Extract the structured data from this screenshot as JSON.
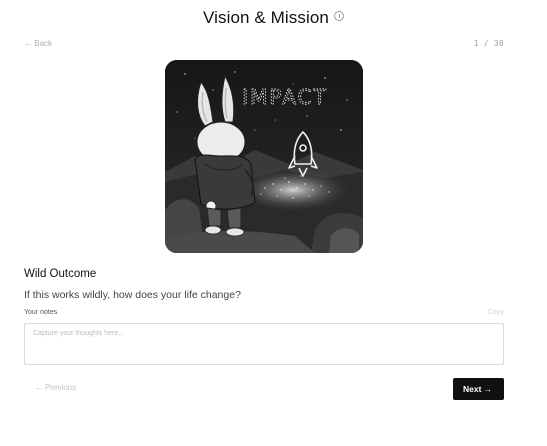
{
  "header": {
    "title": "Vision & Mission"
  },
  "nav": {
    "back_arrow": "←",
    "back_label": "Back",
    "counter": "1 / 30"
  },
  "hero": {
    "image_text": "IMPACT",
    "icon_names": [
      "bunny-illustration",
      "rocket-icon"
    ]
  },
  "prompt": {
    "title": "Wild Outcome",
    "question": "If this works wildly, how does your life change?"
  },
  "notes": {
    "label": "Your notes",
    "copy_label": "Copy",
    "placeholder": "Capture your thoughts here...",
    "value": ""
  },
  "footer": {
    "prev_arrow": "←",
    "prev_label": "Previous",
    "next_label": "Next",
    "next_arrow": "→"
  },
  "colors": {
    "accent": "#111111",
    "border": "#dcdcdc",
    "muted_text": "#b0b0b0"
  }
}
